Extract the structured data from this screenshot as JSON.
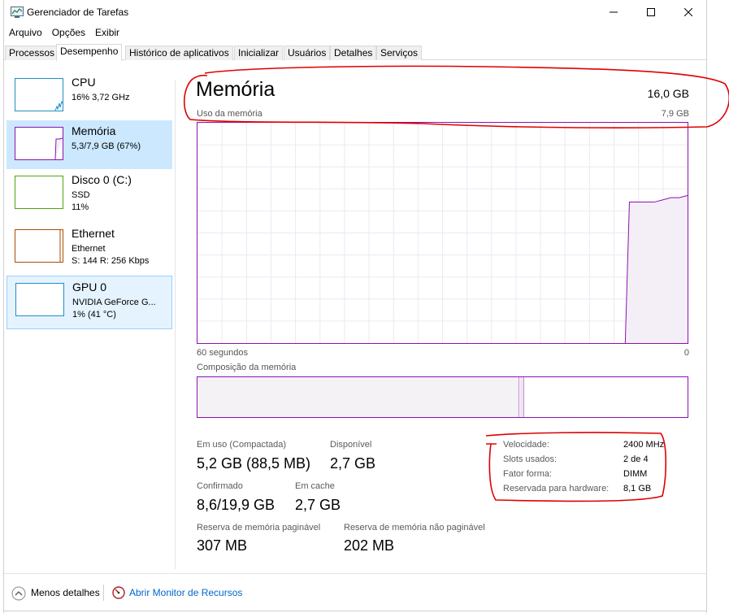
{
  "window": {
    "title": "Gerenciador de Tarefas"
  },
  "menu": [
    "Arquivo",
    "Opções",
    "Exibir"
  ],
  "tabs": [
    "Processos",
    "Desempenho",
    "Histórico de aplicativos",
    "Inicializar",
    "Usuários",
    "Detalhes",
    "Serviços"
  ],
  "active_tab": "Desempenho",
  "sidebar": [
    {
      "name": "CPU",
      "line1": "16% 3,72 GHz",
      "line2": "",
      "color": "#1e8fc8"
    },
    {
      "name": "Memória",
      "line1": "5,3/7,9 GB (67%)",
      "line2": "",
      "color": "#8b12ae"
    },
    {
      "name": "Disco 0 (C:)",
      "line1": "SSD",
      "line2": "11%",
      "color": "#4da60c"
    },
    {
      "name": "Ethernet",
      "line1": "Ethernet",
      "line2": "S: 144 R: 256 Kbps",
      "color": "#a74f01"
    },
    {
      "name": "GPU 0",
      "line1": "NVIDIA GeForce G...",
      "line2": "1% (41 °C)",
      "color": "#1e8fc8"
    }
  ],
  "main": {
    "title": "Memória",
    "total": "16,0 GB",
    "usage_label": "Uso da memória",
    "usage_max": "7,9 GB",
    "time_left": "60 segundos",
    "time_right": "0",
    "composition_label": "Composição da memória",
    "usage_history_fraction": [
      0,
      0,
      0,
      0,
      0,
      0,
      0,
      0,
      0,
      0,
      0,
      0,
      0,
      0,
      0,
      0,
      0,
      0,
      0,
      0,
      0,
      0,
      0,
      0,
      0,
      0,
      0,
      0,
      0,
      0,
      0,
      0,
      0,
      0,
      0,
      0,
      0,
      0,
      0,
      0,
      0,
      0,
      0,
      0,
      0,
      0,
      0,
      0,
      0,
      0,
      0,
      0,
      0.64,
      0.64,
      0.64,
      0.64,
      0.65,
      0.66,
      0.66,
      0.67
    ],
    "composition_fraction": {
      "in_use": 0.656,
      "modified": 0.008
    }
  },
  "stats": {
    "in_use_label": "Em uso (Compactada)",
    "in_use_value": "5,2 GB (88,5 MB)",
    "available_label": "Disponível",
    "available_value": "2,7 GB",
    "committed_label": "Confirmado",
    "committed_value": "8,6/19,9 GB",
    "cached_label": "Em cache",
    "cached_value": "2,7 GB",
    "paged_label": "Reserva de memória paginável",
    "paged_value": "307 MB",
    "nonpaged_label": "Reserva de memória não paginável",
    "nonpaged_value": "202 MB"
  },
  "specs": [
    {
      "label": "Velocidade:",
      "value": "2400 MHz"
    },
    {
      "label": "Slots usados:",
      "value": "2 de 4"
    },
    {
      "label": "Fator forma:",
      "value": "DIMM"
    },
    {
      "label": "Reservada para hardware:",
      "value": "8,1 GB"
    }
  ],
  "footer": {
    "fewer_details": "Menos detalhes",
    "resource_monitor": "Abrir Monitor de Recursos"
  },
  "colors": {
    "memory": "#8b12ae",
    "annotation": "#e00000",
    "link": "#0066cc"
  }
}
